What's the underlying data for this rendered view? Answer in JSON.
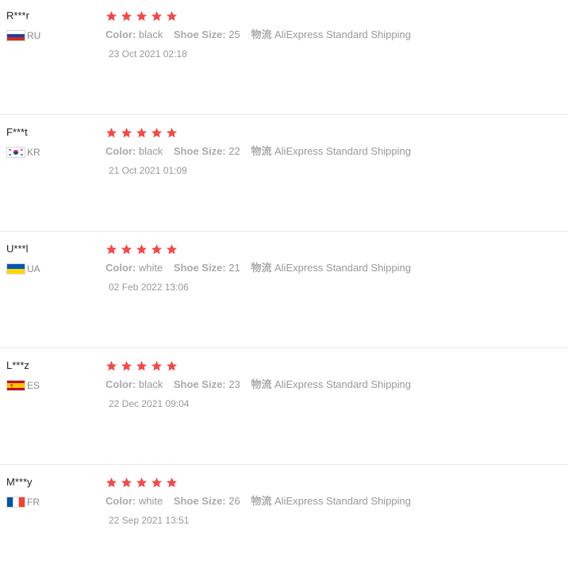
{
  "colors": {
    "star": "#f04b4b",
    "divider": "#e8e8e8",
    "label": "#aaaaaa",
    "muted": "#999999"
  },
  "reviews": [
    {
      "user": "R***r",
      "country": "RU",
      "flag": "ru-flag-icon",
      "rating": 5,
      "props": [
        {
          "key": "Color:",
          "value": "black"
        },
        {
          "key": "Shoe Size:",
          "value": "25"
        },
        {
          "key": "物流",
          "value": "AliExpress Standard Shipping"
        }
      ],
      "date": "23 Oct 2021 02:18"
    },
    {
      "user": "F***t",
      "country": "KR",
      "flag": "kr-flag-icon",
      "rating": 5,
      "props": [
        {
          "key": "Color:",
          "value": "black"
        },
        {
          "key": "Shoe Size:",
          "value": "22"
        },
        {
          "key": "物流",
          "value": "AliExpress Standard Shipping"
        }
      ],
      "date": "21 Oct 2021 01:09"
    },
    {
      "user": "U***l",
      "country": "UA",
      "flag": "ua-flag-icon",
      "rating": 5,
      "props": [
        {
          "key": "Color:",
          "value": "white"
        },
        {
          "key": "Shoe Size:",
          "value": "21"
        },
        {
          "key": "物流",
          "value": "AliExpress Standard Shipping"
        }
      ],
      "date": "02 Feb 2022 13:06"
    },
    {
      "user": "L***z",
      "country": "ES",
      "flag": "es-flag-icon",
      "rating": 5,
      "props": [
        {
          "key": "Color:",
          "value": "black"
        },
        {
          "key": "Shoe Size:",
          "value": "23"
        },
        {
          "key": "物流",
          "value": "AliExpress Standard Shipping"
        }
      ],
      "date": "22 Dec 2021 09:04"
    },
    {
      "user": "M***y",
      "country": "FR",
      "flag": "fr-flag-icon",
      "rating": 5,
      "props": [
        {
          "key": "Color:",
          "value": "white"
        },
        {
          "key": "Shoe Size:",
          "value": "26"
        },
        {
          "key": "物流",
          "value": "AliExpress Standard Shipping"
        }
      ],
      "date": "22 Sep 2021 13:51"
    }
  ]
}
